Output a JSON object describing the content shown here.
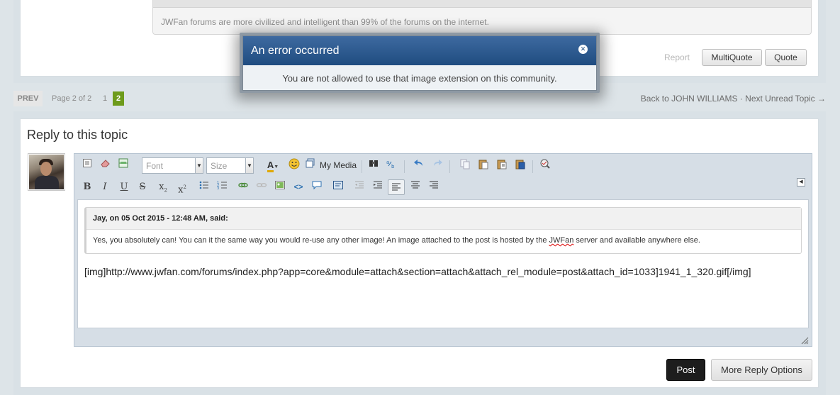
{
  "post": {
    "signature": "JWFan forums are more civilized and intelligent than 99% of the forums on the internet.",
    "report_label": "Report",
    "multiquote_label": "MultiQuote",
    "quote_label": "Quote"
  },
  "pagination": {
    "prev_label": "PREV",
    "page_of": "Page 2 of 2",
    "pages": [
      "1",
      "2"
    ],
    "current_page": "2"
  },
  "topic_nav": {
    "back_label": "Back to JOHN WILLIAMS",
    "separator": "·",
    "next_label": "Next Unread Topic →"
  },
  "reply": {
    "title": "Reply to this topic",
    "font_placeholder": "Font",
    "size_placeholder": "Size",
    "my_media_label": "My Media",
    "quote_header": "Jay, on 05 Oct 2015 - 12:48 AM, said:",
    "quote_text_before": "Yes, you absolutely can!  You can it the same way you would re-use any other image!  An image attached to the post is hosted by the ",
    "quote_text_flagged": "JWFan",
    "quote_text_after": " server and available anywhere else.",
    "editor_text": "[img]http://www.jwfan.com/forums/index.php?app=core&module=attach&section=attach&attach_rel_module=post&attach_id=1033]1941_1_320.gif[/img]",
    "post_label": "Post",
    "more_options_label": "More Reply Options"
  },
  "error_modal": {
    "title": "An error occurred",
    "message": "You are not allowed to use that image extension on this community.",
    "close_icon": "close-icon"
  },
  "colors": {
    "modal_header": "#2a5689",
    "current_page": "#6e9b1b",
    "post_button": "#1d1d1d"
  }
}
